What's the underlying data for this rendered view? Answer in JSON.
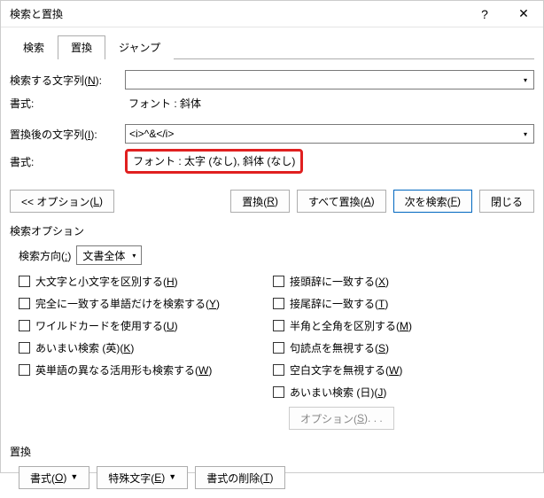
{
  "window": {
    "title": "検索と置換",
    "help": "?",
    "close": "✕"
  },
  "tabs": {
    "search": "検索",
    "replace": "置換",
    "jump": "ジャンプ"
  },
  "form": {
    "findLabelPre": "検索する文字列(",
    "findLabelKey": "N",
    "findLabelPost": "):",
    "findValue": "",
    "findFormatLabel": "書式:",
    "findFormatValue": "フォント : 斜体",
    "replaceLabelPre": "置換後の文字列(",
    "replaceLabelKey": "I",
    "replaceLabelPost": "):",
    "replaceValue": "<i>^&</i>",
    "replaceFormatLabel": "書式:",
    "replaceFormatValue": "フォント : 太字 (なし), 斜体 (なし)"
  },
  "buttons": {
    "optionsLessPre": "<< オプション(",
    "optionsLessKey": "L",
    "optionsLessPost": ")",
    "replacePre": "置換(",
    "replaceKey": "R",
    "replacePost": ")",
    "replaceAllPre": "すべて置換(",
    "replaceAllKey": "A",
    "replaceAllPost": ")",
    "findNextPre": "次を検索(",
    "findNextKey": "F",
    "findNextPost": ")",
    "close": "閉じる"
  },
  "options": {
    "sectionLabel": "検索オプション",
    "directionLabelPre": "検索方向(",
    "directionLabelKey": ":",
    "directionLabelPost": ")",
    "directionValue": "文書全体",
    "matchCasePre": "大文字と小文字を区別する(",
    "matchCaseKey": "H",
    "matchCasePost": ")",
    "wholeWordPre": "完全に一致する単語だけを検索する(",
    "wholeWordKey": "Y",
    "wholeWordPost": ")",
    "wildcardPre": "ワイルドカードを使用する(",
    "wildcardKey": "U",
    "wildcardPost": ")",
    "fuzzyEnPre": "あいまい検索 (英)(",
    "fuzzyEnKey": "K",
    "fuzzyEnPost": ")",
    "wordFormsPre": "英単語の異なる活用形も検索する(",
    "wordFormsKey": "W",
    "wordFormsPost": ")",
    "prefixPre": "接頭辞に一致する(",
    "prefixKey": "X",
    "prefixPost": ")",
    "suffixPre": "接尾辞に一致する(",
    "suffixKey": "T",
    "suffixPost": ")",
    "widthPre": "半角と全角を区別する(",
    "widthKey": "M",
    "widthPost": ")",
    "punctPre": "句読点を無視する(",
    "punctKey": "S",
    "punctPost": ")",
    "whitespacePre": "空白文字を無視する(",
    "whitespaceKey": "W",
    "whitespacePost": ")",
    "fuzzyJpPre": "あいまい検索 (日)(",
    "fuzzyJpKey": "J",
    "fuzzyJpPost": ")",
    "fuzzyOptionsPre": "オプション(",
    "fuzzyOptionsKey": "S",
    "fuzzyOptionsPost": "). . ."
  },
  "footer": {
    "sectionLabel": "置換",
    "formatPre": "書式(",
    "formatKey": "O",
    "formatPost": ")",
    "specialPre": "特殊文字(",
    "specialKey": "E",
    "specialPost": ")",
    "noFormatPre": "書式の削除(",
    "noFormatKey": "T",
    "noFormatPost": ")"
  }
}
